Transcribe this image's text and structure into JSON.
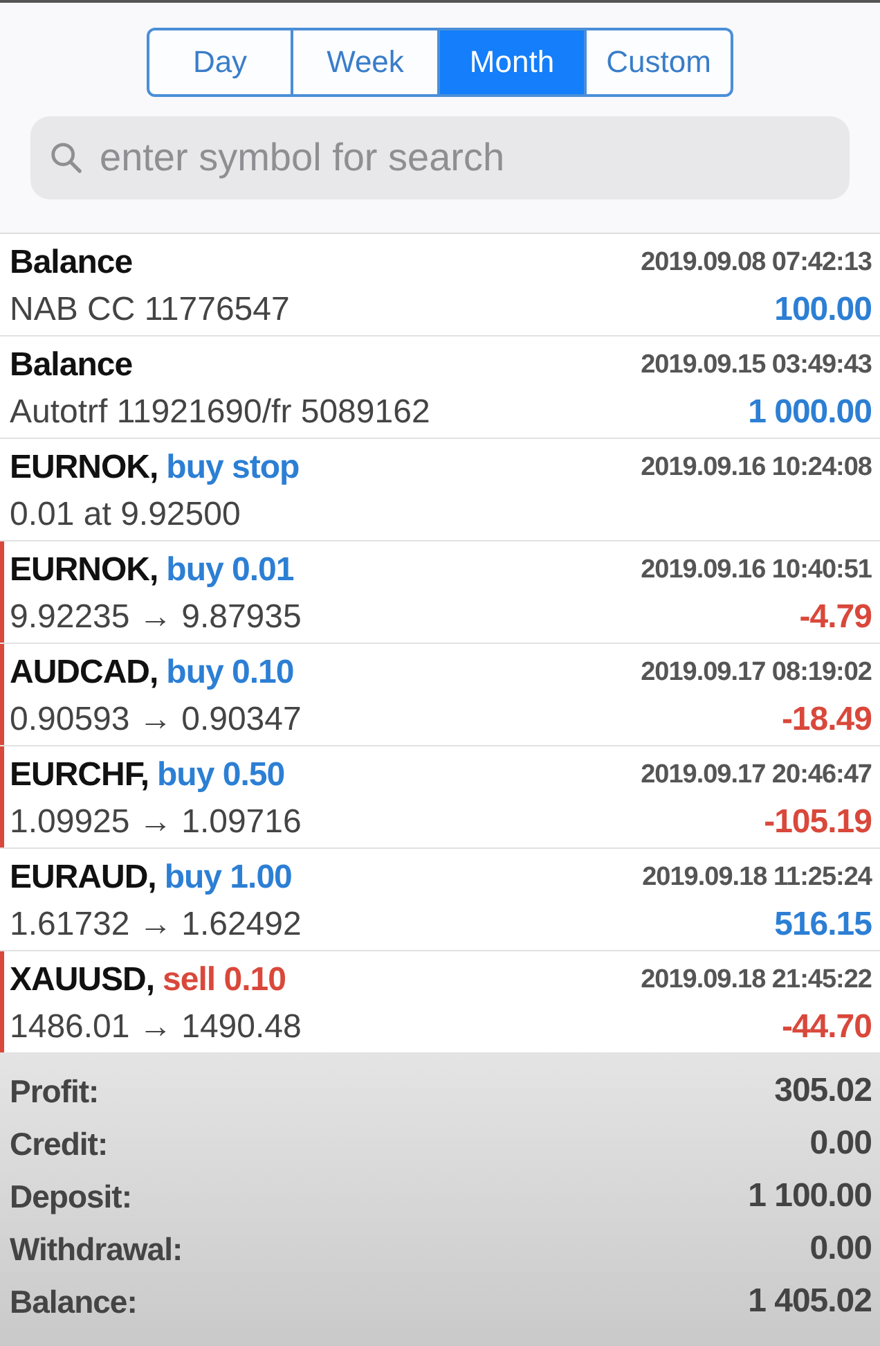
{
  "periods": [
    {
      "label": "Day",
      "selected": false
    },
    {
      "label": "Week",
      "selected": false
    },
    {
      "label": "Month",
      "selected": true
    },
    {
      "label": "Custom",
      "selected": false
    }
  ],
  "search": {
    "placeholder": "enter symbol for search"
  },
  "entries": [
    {
      "kind": "balance",
      "title": "Balance",
      "time": "2019.09.08 07:42:13",
      "detail": "NAB CC 11776547",
      "value": "100.00",
      "loss": false
    },
    {
      "kind": "balance",
      "title": "Balance",
      "time": "2019.09.15 03:49:43",
      "detail": "Autotrf 11921690/fr 5089162",
      "value": "1 000.00",
      "loss": false
    },
    {
      "kind": "order",
      "title": "EURNOK,",
      "action": "buy stop",
      "sell": false,
      "time": "2019.09.16 10:24:08",
      "detail": "0.01 at 9.92500"
    },
    {
      "kind": "trade",
      "title": "EURNOK,",
      "action": "buy 0.01",
      "sell": false,
      "time": "2019.09.16 10:40:51",
      "open": "9.92235",
      "arrow": "→",
      "close": "9.87935",
      "value": "-4.79",
      "loss": true
    },
    {
      "kind": "trade",
      "title": "AUDCAD,",
      "action": "buy 0.10",
      "sell": false,
      "time": "2019.09.17 08:19:02",
      "open": "0.90593",
      "arrow": "→",
      "close": "0.90347",
      "value": "-18.49",
      "loss": true
    },
    {
      "kind": "trade",
      "title": "EURCHF,",
      "action": "buy 0.50",
      "sell": false,
      "time": "2019.09.17 20:46:47",
      "open": "1.09925",
      "arrow": "→",
      "close": "1.09716",
      "value": "-105.19",
      "loss": true
    },
    {
      "kind": "trade",
      "title": "EURAUD,",
      "action": "buy 1.00",
      "sell": false,
      "time": "2019.09.18 11:25:24",
      "open": "1.61732",
      "arrow": "→",
      "close": "1.62492",
      "value": "516.15",
      "loss": false
    },
    {
      "kind": "trade",
      "title": "XAUUSD,",
      "action": "sell 0.10",
      "sell": true,
      "time": "2019.09.18 21:45:22",
      "open": "1486.01",
      "arrow": "→",
      "close": "1490.48",
      "value": "-44.70",
      "loss": true
    }
  ],
  "summary": [
    {
      "label": "Profit:",
      "value": "305.02"
    },
    {
      "label": "Credit:",
      "value": "0.00"
    },
    {
      "label": "Deposit:",
      "value": "1 100.00"
    },
    {
      "label": "Withdrawal:",
      "value": "0.00"
    },
    {
      "label": "Balance:",
      "value": "1 405.02"
    }
  ]
}
